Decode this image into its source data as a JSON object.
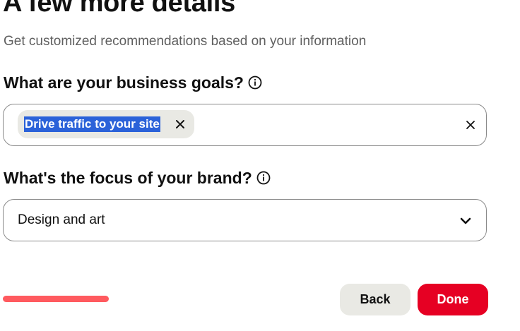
{
  "header": {
    "title": "A few more details",
    "subtitle": "Get customized recommendations based on your information"
  },
  "goals": {
    "label": "What are your business goals?",
    "info_icon": "info-icon",
    "selected_chips": [
      {
        "label": "Drive traffic to your site",
        "remove_icon": "close-icon"
      }
    ],
    "clear_icon": "close-icon"
  },
  "focus": {
    "label": "What's the focus of your brand?",
    "info_icon": "info-icon",
    "selected_value": "Design and art",
    "dropdown_icon": "chevron-down-icon"
  },
  "progress": {
    "fraction": 1.0,
    "color": "#ff5a5f"
  },
  "actions": {
    "back_label": "Back",
    "done_label": "Done"
  },
  "colors": {
    "primary": "#e60023",
    "secondary_button": "#e9e9e4",
    "selection_highlight": "#2b62d9"
  }
}
